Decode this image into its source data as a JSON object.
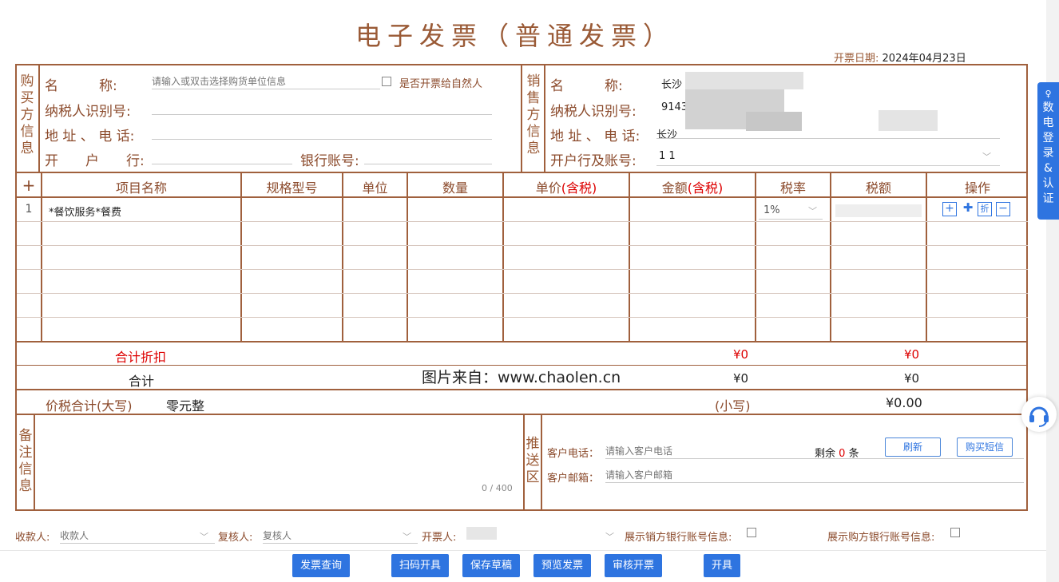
{
  "invoice": {
    "title": "电子发票（普通发票）",
    "date_label": "开票日期:",
    "date_value": "2024年04月23日"
  },
  "buyer": {
    "section_label": "购买方信息",
    "name_label": "名　　　称:",
    "name_placeholder": "请输入或双击选择购货单位信息",
    "natural_person_label": "是否开票给自然人",
    "taxid_label": "纳税人识别号:",
    "address_label": "地 址 、 电 话:",
    "bank_label": "开　　户　　行:",
    "account_label": "银行账号:"
  },
  "seller": {
    "section_label": "销售方信息",
    "name_label": "名　　　称:",
    "name_value": "长沙",
    "taxid_label": "纳税人识别号:",
    "taxid_value": "9143",
    "address_label": "地 址 、 电 话:",
    "address_value": "长沙",
    "bank_label": "开户行及账号:",
    "bank_value": "1 1"
  },
  "items": {
    "add_symbol": "+",
    "headers": [
      "项目名称",
      "规格型号",
      "单位",
      "数量",
      "单价",
      "金额",
      "税率",
      "税额",
      "操作"
    ],
    "tax_incl": "(含税)",
    "row1": {
      "index": "1",
      "name": "*餐饮服务*餐费",
      "tax_rate": "1%"
    },
    "row_icons": [
      "+",
      "✚",
      "折",
      "−"
    ]
  },
  "totals": {
    "discount_label": "合计折扣",
    "discount_amount": "¥0",
    "discount_tax": "¥0",
    "sum_label": "合计",
    "sum_amount": "¥0",
    "sum_tax": "¥0",
    "watermark": "图片来自：www.chaolen.cn",
    "capital_label": "价税合计(大写)",
    "capital_value": "零元整",
    "small_label": "(小写)",
    "small_value": "¥0.00"
  },
  "remarks": {
    "label": "备注信息",
    "counter": "0 / 400"
  },
  "push": {
    "label": "推送区",
    "phone_label": "客户电话：",
    "phone_placeholder": "请输入客户电话",
    "remaining_prefix": "剩余",
    "remaining_count": "0",
    "remaining_suffix": "条",
    "refresh_button": "刷新",
    "buy_sms_button": "购买短信",
    "email_label": "客户邮箱：",
    "email_placeholder": "请输入客户邮箱"
  },
  "footer": {
    "payee_label": "收款人:",
    "payee_placeholder": "收款人",
    "reviewer_label": "复核人:",
    "reviewer_placeholder": "复核人",
    "issuer_label": "开票人:",
    "show_seller_bank": "展示销方银行账号信息:",
    "show_buyer_bank": "展示购方银行账号信息:"
  },
  "buttons": {
    "query": "发票查询",
    "scan": "扫码开具",
    "draft": "保存草稿",
    "preview": "预览发票",
    "review": "审核开票",
    "issue": "开具"
  },
  "side_tab": {
    "label": "数电登录&认证"
  },
  "colors": {
    "frame": "#a0603d",
    "accent": "#2e74e0",
    "red": "#dd0000"
  }
}
